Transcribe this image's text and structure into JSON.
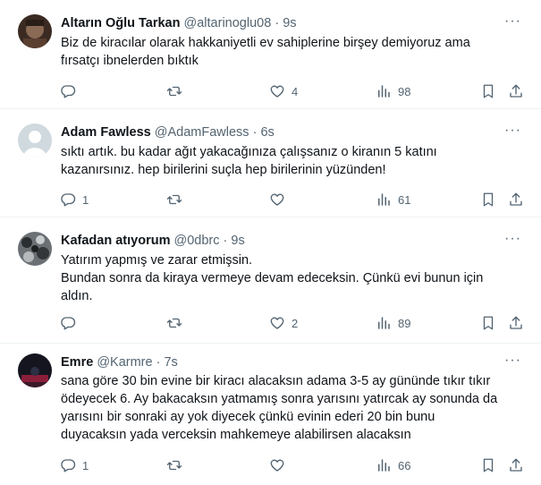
{
  "tweets": [
    {
      "name": "Altarın Oğlu Tarkan",
      "handle": "@altarinoglu08",
      "time": "9s",
      "text_lines": [
        "Biz de kiracılar olarak hakkaniyetli ev sahiplerine birşey demiyoruz ama",
        "fırsatçı ibnelerden bıktık"
      ],
      "replies": "",
      "retweets": "",
      "likes": "4",
      "views": "98",
      "avatar_color": "#6b4a3a"
    },
    {
      "name": "Adam Fawless",
      "handle": "@AdamFawless",
      "time": "6s",
      "text_lines": [
        "sıktı artık. bu kadar ağıt yakacağınıza çalışsanız o kiranın 5 katını",
        "kazanırsınız. hep birilerini suçla hep birilerinin yüzünden!"
      ],
      "replies": "1",
      "retweets": "",
      "likes": "",
      "views": "61",
      "avatar_color": "#cfd9de"
    },
    {
      "name": "Kafadan atıyorum",
      "handle": "@0dbrc",
      "time": "9s",
      "text_lines": [
        "Yatırım yapmış ve zarar etmişsin.",
        "Bundan sonra da kiraya vermeye devam edeceksin. Çünkü evi bunun için",
        "aldın."
      ],
      "replies": "",
      "retweets": "",
      "likes": "2",
      "views": "89",
      "avatar_color": "#5a5f63"
    },
    {
      "name": "Emre",
      "handle": "@Karmre",
      "time": "7s",
      "text_lines": [
        "sana göre 30 bin evine bir kiracı alacaksın adama 3-5 ay gününde tıkır tıkır",
        "ödeyecek 6. Ay bakacaksın yatmamış sonra yarısını yatırcak ay sonunda da",
        "yarısını bir sonraki ay yok diyecek çünkü evinin ederi 20 bin bunu",
        "duyacaksın yada verceksin mahkemeye alabilirsen alacaksın"
      ],
      "replies": "1",
      "retweets": "",
      "likes": "",
      "views": "66",
      "avatar_color": "#1c1d2b"
    }
  ],
  "icons": {
    "reply": "reply-icon",
    "retweet": "retweet-icon",
    "like": "heart-icon",
    "views": "views-icon",
    "bookmark": "bookmark-icon",
    "share": "share-icon",
    "more": "more-icon"
  },
  "colors": {
    "text": "#0f1419",
    "secondary": "#536471",
    "divider": "#eff3f4"
  }
}
